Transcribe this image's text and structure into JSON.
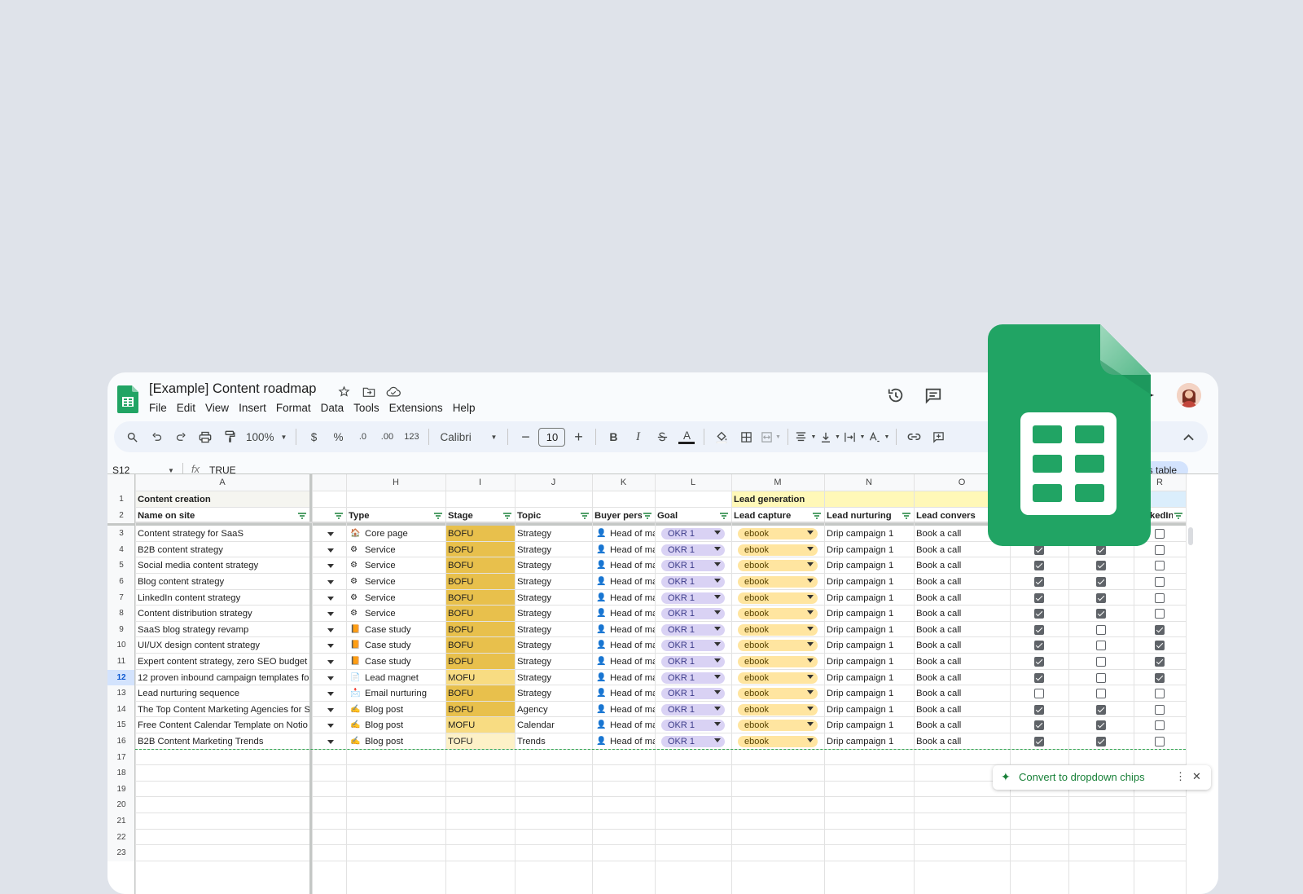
{
  "app": {
    "doc_title": "[Example] Content roadmap",
    "menu": [
      "File",
      "Edit",
      "View",
      "Insert",
      "Format",
      "Data",
      "Tools",
      "Extensions",
      "Help"
    ],
    "icons": {
      "star": "star-icon",
      "move": "folder-move-icon",
      "cloud": "cloud-status-icon",
      "history": "history-icon",
      "comments": "comment-icon",
      "gemini": "sparkle-icon",
      "account": "avatar"
    }
  },
  "toolbar": {
    "zoom": "100%",
    "currency": "$",
    "percent": "%",
    "dec_decrease": ".0",
    "dec_increase": ".00",
    "number_format": "123",
    "font": "Calibri",
    "font_size": "10",
    "minus": "−",
    "plus": "+",
    "bold": "B",
    "italic": "I",
    "underline_color": "A"
  },
  "formula_bar": {
    "cell_ref": "S12",
    "fx": "fx",
    "value": "TRUE"
  },
  "explore_chip": "e this table",
  "columns": {
    "A": "A",
    "H": "H",
    "I": "I",
    "J": "J",
    "K": "K",
    "L": "L",
    "M": "M",
    "N": "N",
    "O": "O",
    "R": "R"
  },
  "sections": {
    "content_creation": "Content creation",
    "lead_generation": "Lead generation"
  },
  "headers": {
    "name": "Name on site",
    "type": "Type",
    "stage": "Stage",
    "topic": "Topic",
    "buyer": "Buyer pers",
    "goal": "Goal",
    "lead_capture": "Lead capture",
    "lead_nurturing": "Lead nurturing",
    "lead_conversion": "Lead convers",
    "linkedin": "LinkedIn"
  },
  "row_numbers": [
    "1",
    "2",
    "3",
    "4",
    "5",
    "6",
    "7",
    "8",
    "9",
    "10",
    "11",
    "12",
    "13",
    "14",
    "15",
    "16",
    "17",
    "18",
    "19",
    "20",
    "21",
    "22",
    "23"
  ],
  "rows": [
    {
      "name": "Content strategy for SaaS",
      "type_icon": "🏠",
      "type": "Core page",
      "stage": "BOFU",
      "topic": "Strategy",
      "buyer": "Head of ma",
      "goal": "OKR 1",
      "capture": "ebook",
      "nurture": "Drip campaign 1",
      "convert": "Book a call",
      "c1": true,
      "c2": true,
      "c3": false
    },
    {
      "name": "B2B content strategy",
      "type_icon": "⚙",
      "type": "Service",
      "stage": "BOFU",
      "topic": "Strategy",
      "buyer": "Head of ma",
      "goal": "OKR 1",
      "capture": "ebook",
      "nurture": "Drip campaign 1",
      "convert": "Book a call",
      "c1": true,
      "c2": true,
      "c3": false
    },
    {
      "name": "Social media content strategy",
      "type_icon": "⚙",
      "type": "Service",
      "stage": "BOFU",
      "topic": "Strategy",
      "buyer": "Head of ma",
      "goal": "OKR 1",
      "capture": "ebook",
      "nurture": "Drip campaign 1",
      "convert": "Book a call",
      "c1": true,
      "c2": true,
      "c3": false
    },
    {
      "name": "Blog content strategy",
      "type_icon": "⚙",
      "type": "Service",
      "stage": "BOFU",
      "topic": "Strategy",
      "buyer": "Head of ma",
      "goal": "OKR 1",
      "capture": "ebook",
      "nurture": "Drip campaign 1",
      "convert": "Book a call",
      "c1": true,
      "c2": true,
      "c3": false
    },
    {
      "name": "LinkedIn content strategy",
      "type_icon": "⚙",
      "type": "Service",
      "stage": "BOFU",
      "topic": "Strategy",
      "buyer": "Head of ma",
      "goal": "OKR 1",
      "capture": "ebook",
      "nurture": "Drip campaign 1",
      "convert": "Book a call",
      "c1": true,
      "c2": true,
      "c3": false
    },
    {
      "name": "Content distribution strategy",
      "type_icon": "⚙",
      "type": "Service",
      "stage": "BOFU",
      "topic": "Strategy",
      "buyer": "Head of ma",
      "goal": "OKR 1",
      "capture": "ebook",
      "nurture": "Drip campaign 1",
      "convert": "Book a call",
      "c1": true,
      "c2": true,
      "c3": false
    },
    {
      "name": "SaaS blog strategy revamp",
      "type_icon": "📙",
      "type": "Case study",
      "stage": "BOFU",
      "topic": "Strategy",
      "buyer": "Head of ma",
      "goal": "OKR 1",
      "capture": "ebook",
      "nurture": "Drip campaign 1",
      "convert": "Book a call",
      "c1": true,
      "c2": false,
      "c3": true
    },
    {
      "name": "UI/UX design content strategy",
      "type_icon": "📙",
      "type": "Case study",
      "stage": "BOFU",
      "topic": "Strategy",
      "buyer": "Head of ma",
      "goal": "OKR 1",
      "capture": "ebook",
      "nurture": "Drip campaign 1",
      "convert": "Book a call",
      "c1": true,
      "c2": false,
      "c3": true
    },
    {
      "name": "Expert content strategy, zero SEO budget",
      "type_icon": "📙",
      "type": "Case study",
      "stage": "BOFU",
      "topic": "Strategy",
      "buyer": "Head of ma",
      "goal": "OKR 1",
      "capture": "ebook",
      "nurture": "Drip campaign 1",
      "convert": "Book a call",
      "c1": true,
      "c2": false,
      "c3": true
    },
    {
      "name": "12 proven inbound campaign templates fo",
      "type_icon": "📄",
      "type": "Lead magnet",
      "stage": "MOFU",
      "topic": "Strategy",
      "buyer": "Head of ma",
      "goal": "OKR 1",
      "capture": "ebook",
      "nurture": "Drip campaign 1",
      "convert": "Book a call",
      "c1": true,
      "c2": false,
      "c3": true
    },
    {
      "name": "Lead nurturing sequence",
      "type_icon": "📩",
      "type": "Email nurturing",
      "stage": "BOFU",
      "topic": "Strategy",
      "buyer": "Head of ma",
      "goal": "OKR 1",
      "capture": "ebook",
      "nurture": "Drip campaign 1",
      "convert": "Book a call",
      "c1": false,
      "c2": false,
      "c3": false
    },
    {
      "name": "The Top Content Marketing Agencies for S",
      "type_icon": "✍",
      "type": "Blog post",
      "stage": "BOFU",
      "topic": "Agency",
      "buyer": "Head of ma",
      "goal": "OKR 1",
      "capture": "ebook",
      "nurture": "Drip campaign 1",
      "convert": "Book a call",
      "c1": true,
      "c2": true,
      "c3": false
    },
    {
      "name": "Free Content Calendar Template on Notio",
      "type_icon": "✍",
      "type": "Blog post",
      "stage": "MOFU",
      "topic": "Calendar",
      "buyer": "Head of ma",
      "goal": "OKR 1",
      "capture": "ebook",
      "nurture": "Drip campaign 1",
      "convert": "Book a call",
      "c1": true,
      "c2": true,
      "c3": false
    },
    {
      "name": "B2B Content Marketing Trends",
      "type_icon": "✍",
      "type": "Blog post",
      "stage": "TOFU",
      "topic": "Trends",
      "buyer": "Head of ma",
      "goal": "OKR 1",
      "capture": "ebook",
      "nurture": "Drip campaign 1",
      "convert": "Book a call",
      "c1": true,
      "c2": true,
      "c3": false
    }
  ],
  "stage_colors": {
    "BOFU": "#e8c04c",
    "MOFU": "#f8dc82",
    "TOFU": "#fdf1c7"
  },
  "convert_popup": {
    "label": "Convert to dropdown chips",
    "more": "⋮",
    "close": "✕"
  },
  "colors": {
    "sheets_green": "#188038",
    "section_yellow": "#fff8b8",
    "okr_chip": "#d9d2f4",
    "ebook_chip": "#ffe5a0"
  }
}
